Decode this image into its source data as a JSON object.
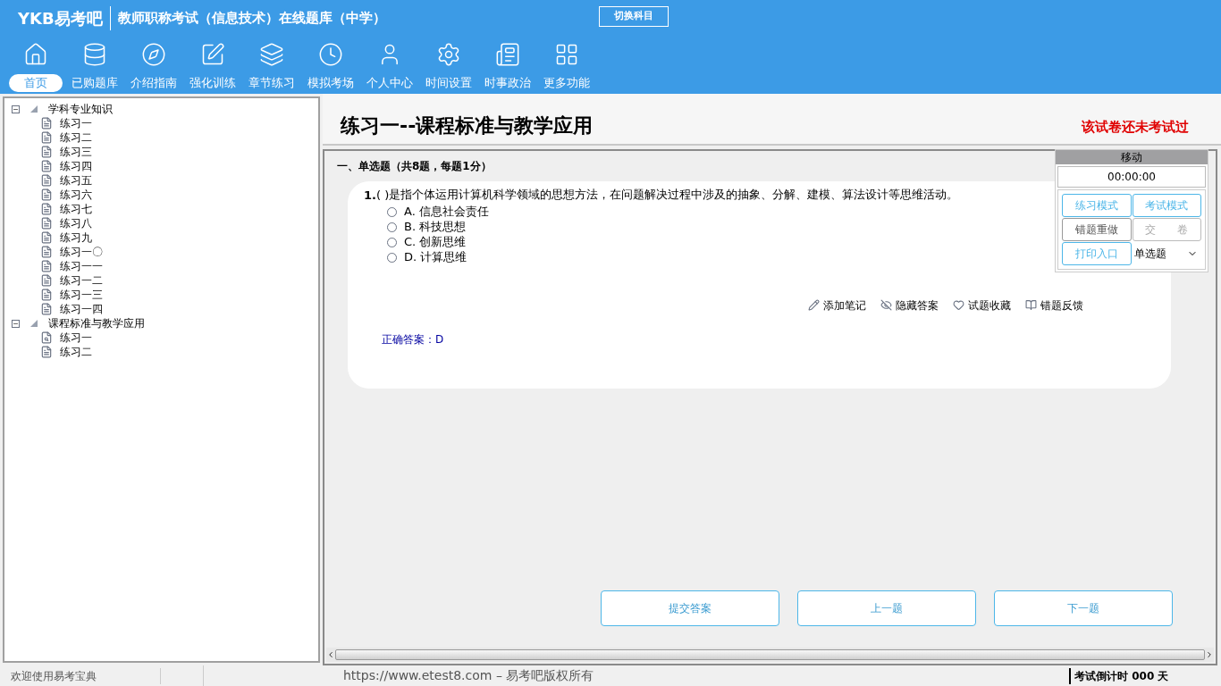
{
  "header": {
    "logo": "YKB易考吧",
    "title": "教师职称考试（信息技术）在线题库（中学）",
    "switch_button": "切换科目"
  },
  "toolbar": [
    {
      "label": "首页",
      "selected": true
    },
    {
      "label": "已购题库",
      "selected": false
    },
    {
      "label": "介绍指南",
      "selected": false
    },
    {
      "label": "强化训练",
      "selected": false
    },
    {
      "label": "章节练习",
      "selected": false
    },
    {
      "label": "模拟考场",
      "selected": false
    },
    {
      "label": "个人中心",
      "selected": false
    },
    {
      "label": "时间设置",
      "selected": false
    },
    {
      "label": "时事政治",
      "selected": false
    },
    {
      "label": "更多功能",
      "selected": false
    }
  ],
  "tree": [
    {
      "label": "学科专业知识",
      "expanded": true,
      "children": [
        {
          "label": "练习一",
          "kind": "page"
        },
        {
          "label": "练习二",
          "kind": "page"
        },
        {
          "label": "练习三",
          "kind": "page"
        },
        {
          "label": "练习四",
          "kind": "page"
        },
        {
          "label": "练习五",
          "kind": "page"
        },
        {
          "label": "练习六",
          "kind": "page"
        },
        {
          "label": "练习七",
          "kind": "page"
        },
        {
          "label": "练习八",
          "kind": "page"
        },
        {
          "label": "练习九",
          "kind": "page"
        },
        {
          "label": "练习一〇",
          "kind": "page"
        },
        {
          "label": "练习一一",
          "kind": "page"
        },
        {
          "label": "练习一二",
          "kind": "page"
        },
        {
          "label": "练习一三",
          "kind": "page"
        },
        {
          "label": "练习一四",
          "kind": "page"
        }
      ]
    },
    {
      "label": "课程标准与教学应用",
      "expanded": true,
      "children": [
        {
          "label": "练习一",
          "kind": "current"
        },
        {
          "label": "练习二",
          "kind": "page"
        }
      ]
    }
  ],
  "paper": {
    "title": "练习一--课程标准与教学应用",
    "status": "该试卷还未考试过",
    "section": "一、单选题（共8题，每题1分）",
    "question": {
      "number": "1.",
      "blank": "( )",
      "text": "是指个体运用计算机科学领域的思想方法，在问题解决过程中涉及的抽象、分解、建模、算法设计等思维活动。",
      "options": [
        {
          "label": "A. 信息社会责任",
          "checked": false
        },
        {
          "label": "B. 科技思想",
          "checked": false
        },
        {
          "label": "C. 创新思维",
          "checked": false
        },
        {
          "label": "D. 计算思维",
          "checked": false
        }
      ],
      "actions": [
        "添加笔记",
        "隐藏答案",
        "试题收藏",
        "错题反馈"
      ],
      "answer": "正确答案：D"
    },
    "buttons": [
      "提交答案",
      "上一题",
      "下一题"
    ]
  },
  "float_panel": {
    "header": "移动",
    "timer": "00:00:00",
    "buttons": [
      {
        "label": "练习模式",
        "highlighted": true,
        "disabled": false
      },
      {
        "label": "考试模式",
        "highlighted": true,
        "disabled": false
      },
      {
        "label": "错题重做",
        "highlighted": false,
        "disabled": false
      },
      {
        "label": "交　　卷",
        "highlighted": false,
        "disabled": true
      },
      {
        "label": "打印入口",
        "highlighted": true,
        "disabled": false
      }
    ],
    "type_select": "单选题"
  },
  "status_bar": {
    "welcome": "欢迎使用易考宝典",
    "copyright": "https://www.etest8.com – 易考吧版权所有",
    "countdown": "考试倒计时 000 天"
  }
}
